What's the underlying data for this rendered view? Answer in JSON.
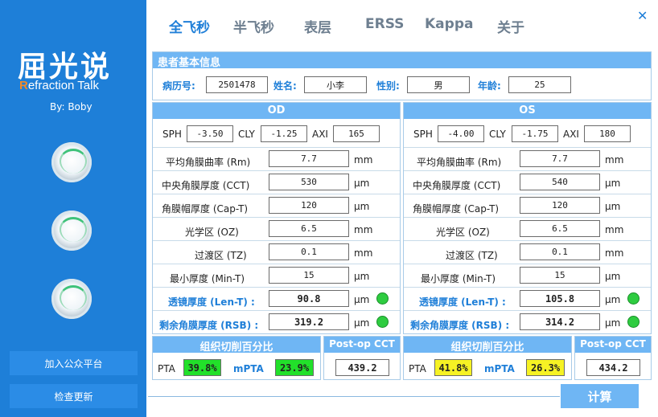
{
  "app": {
    "logo_title": "屈光说",
    "logo_sub_r": "R",
    "logo_sub_rest": "efraction Talk",
    "author": "By: Boby"
  },
  "sidebar": {
    "join_label": "加入公众平台",
    "update_label": "检查更新"
  },
  "tabs": [
    "全飞秒",
    "半飞秒",
    "表层",
    "ERSS",
    "Kappa",
    "关于"
  ],
  "close_icon": "close-icon",
  "patient": {
    "title": "患者基本信息",
    "id_label": "病历号:",
    "id": "2501478",
    "name_label": "姓名:",
    "name": "小李",
    "sex_label": "性别:",
    "sex": "男",
    "age_label": "年龄:",
    "age": "25"
  },
  "labels": {
    "sph": "SPH",
    "cyl": "CLY",
    "axi": "AXI",
    "rm": "平均角膜曲率 (Rm)",
    "cct": "中央角膜厚度 (CCT)",
    "cap": "角膜帽厚度 (Cap-T)",
    "oz": "光学区 (OZ)",
    "tz": "过渡区 (TZ)",
    "min": "最小厚度 (Min-T)",
    "len": "透镜厚度 (Len-T) :",
    "rsb": "剩余角膜厚度 (RSB) :",
    "mm": "mm",
    "um": "μm",
    "ratio_title": "组织切削百分比",
    "postop_title": "Post-op CCT",
    "pta": "PTA",
    "mpta": "mPTA"
  },
  "od": {
    "title": "OD",
    "sph": "-3.50",
    "cyl": "-1.25",
    "axi": "165",
    "rm": "7.7",
    "cct": "530",
    "cap": "120",
    "oz": "6.5",
    "tz": "0.1",
    "min": "15",
    "len": "90.8",
    "rsb": "319.2",
    "pta": "39.8%",
    "mpta": "23.9%",
    "postop": "439.2",
    "pta_color": "#22e02a",
    "mpta_color": "#22e02a"
  },
  "os": {
    "title": "OS",
    "sph": "-4.00",
    "cyl": "-1.75",
    "axi": "180",
    "rm": "7.7",
    "cct": "540",
    "cap": "120",
    "oz": "6.5",
    "tz": "0.1",
    "min": "15",
    "len": "105.8",
    "rsb": "314.2",
    "pta": "41.8%",
    "mpta": "26.3%",
    "postop": "434.2",
    "pta_color": "#f6f224",
    "mpta_color": "#f6f224"
  },
  "calc_label": "计算",
  "colors": {
    "sidebar": "#1e7fd8",
    "accent": "#1f7fd8",
    "bar": "#6fb6f4",
    "ok": "#2ecc40"
  }
}
